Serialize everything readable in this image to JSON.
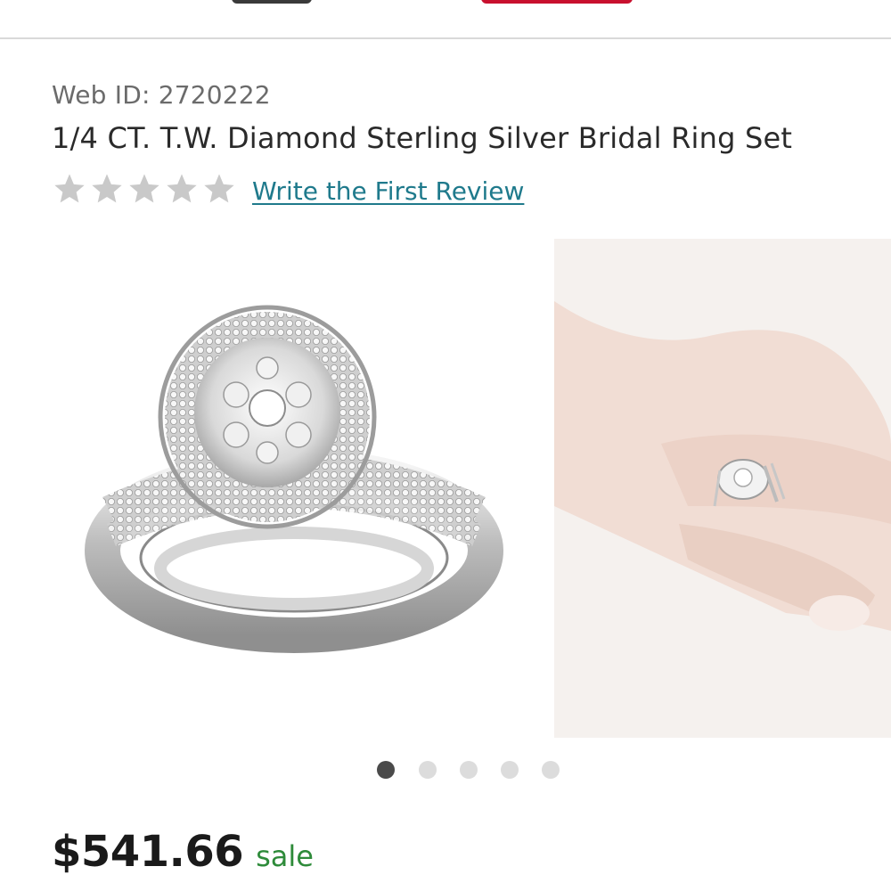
{
  "product": {
    "web_id": "Web ID: 2720222",
    "title": "1/4 CT. T.W. Diamond Sterling Silver Bridal Ring Set",
    "rating": {
      "value": 0,
      "max": 5,
      "empty_color": "#c9c9c9"
    },
    "review_link": "Write the First Review",
    "price": "$541.66",
    "price_tag": "sale"
  },
  "gallery": {
    "images": [
      {
        "name": "ring-product-photo"
      },
      {
        "name": "ring-on-hand-photo"
      }
    ],
    "dots": {
      "count": 5,
      "active_index": 0
    }
  },
  "colors": {
    "link": "#1f7a8c",
    "sale": "#2e8b3a",
    "dot_active": "#4a4a4a",
    "dot_inactive": "#dcdcdc"
  }
}
